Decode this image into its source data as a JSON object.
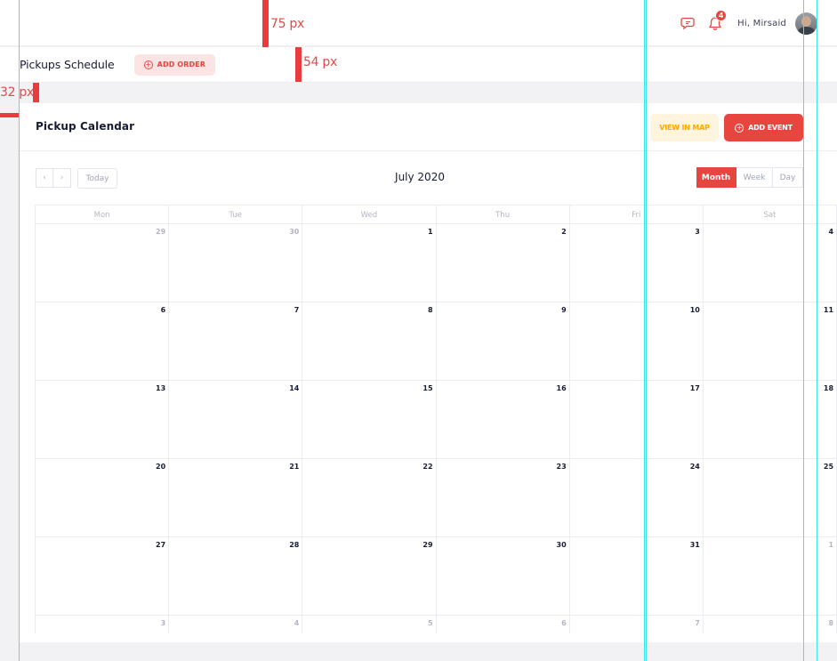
{
  "header": {
    "notification_count": "4",
    "greeting": "Hi,  Mirsaid",
    "icons": [
      "chat-icon",
      "bell-icon"
    ]
  },
  "subheader": {
    "title": "Pickups Schedule",
    "add_order_label": "ADD ORDER"
  },
  "card": {
    "title": "Pickup Calendar",
    "view_in_map_label": "VIEW IN MAP",
    "add_event_label": "ADD EVENT"
  },
  "calendar": {
    "title": "July 2020",
    "prev_icon": "‹",
    "next_icon": "›",
    "today_label": "Today",
    "views": [
      "Month",
      "Week",
      "Day"
    ],
    "active_view": "Month",
    "weekdays": [
      "Mon",
      "Tue",
      "Wed",
      "Thu",
      "Fri",
      "Sat"
    ],
    "weeks": [
      [
        {
          "n": "29",
          "o": true
        },
        {
          "n": "30",
          "o": true
        },
        {
          "n": "1"
        },
        {
          "n": "2"
        },
        {
          "n": "3"
        },
        {
          "n": "4"
        }
      ],
      [
        {
          "n": "6"
        },
        {
          "n": "7"
        },
        {
          "n": "8"
        },
        {
          "n": "9"
        },
        {
          "n": "10"
        },
        {
          "n": "11"
        }
      ],
      [
        {
          "n": "13"
        },
        {
          "n": "14"
        },
        {
          "n": "15"
        },
        {
          "n": "16"
        },
        {
          "n": "17"
        },
        {
          "n": "18"
        }
      ],
      [
        {
          "n": "20"
        },
        {
          "n": "21"
        },
        {
          "n": "22"
        },
        {
          "n": "23"
        },
        {
          "n": "24"
        },
        {
          "n": "25"
        }
      ],
      [
        {
          "n": "27"
        },
        {
          "n": "28"
        },
        {
          "n": "29"
        },
        {
          "n": "30"
        },
        {
          "n": "31"
        },
        {
          "n": "1",
          "o": true
        }
      ],
      [
        {
          "n": "3",
          "o": true
        },
        {
          "n": "4",
          "o": true
        },
        {
          "n": "5",
          "o": true
        },
        {
          "n": "6",
          "o": true
        },
        {
          "n": "7",
          "o": true
        },
        {
          "n": "8",
          "o": true
        }
      ]
    ]
  },
  "annotations": {
    "header_height": "75 px",
    "subheader_height": "54 px",
    "side_margin": "32 px"
  },
  "colors": {
    "accent": "#e8453f",
    "warning": "#ffa800",
    "guide": "#3fe3ea"
  }
}
